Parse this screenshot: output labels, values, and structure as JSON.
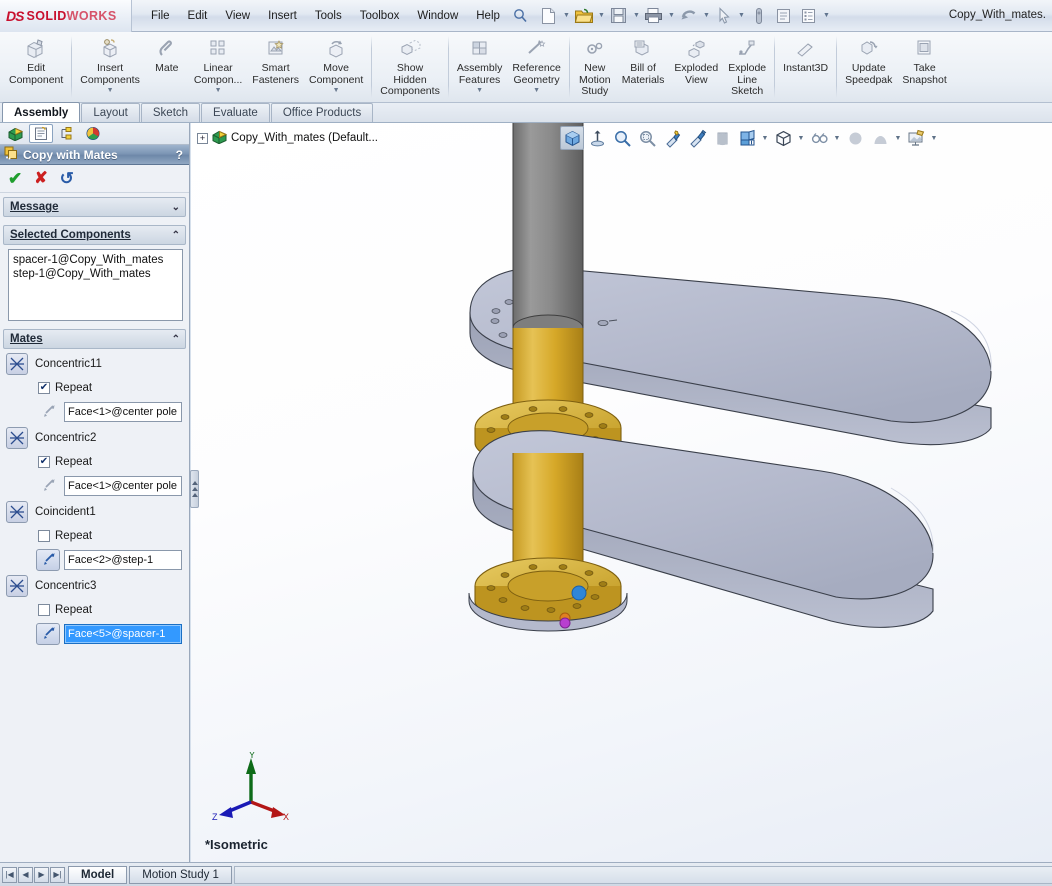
{
  "titlebar": {
    "brand_ds": "DS",
    "brand_solid": "SOLID",
    "brand_works": "WORKS",
    "document_title": "Copy_With_mates.",
    "menus": [
      "File",
      "Edit",
      "View",
      "Insert",
      "Tools",
      "Toolbox",
      "Window",
      "Help"
    ],
    "quick_icons": [
      {
        "name": "new-document-icon",
        "caret": true
      },
      {
        "name": "open-folder-icon",
        "caret": true
      },
      {
        "name": "save-icon",
        "caret": true
      },
      {
        "name": "print-icon",
        "caret": true
      },
      {
        "name": "undo-icon",
        "caret": true
      },
      {
        "name": "select-cursor-icon",
        "caret": true
      },
      {
        "name": "rebuild-icon",
        "caret": false
      },
      {
        "name": "options-icon",
        "caret": false
      },
      {
        "name": "properties-icon",
        "caret": true
      }
    ],
    "search_icon": "search-icon"
  },
  "ribbon": {
    "buttons": [
      {
        "label": "Edit\nComponent",
        "icon": "edit-component-icon",
        "dropdown": false,
        "sep_after": true
      },
      {
        "label": "Insert\nComponents",
        "icon": "insert-components-icon",
        "dropdown": true,
        "sep_after": false
      },
      {
        "label": "Mate",
        "icon": "mate-icon",
        "dropdown": false,
        "sep_after": false
      },
      {
        "label": "Linear\nCompon...",
        "icon": "linear-component-pattern-icon",
        "dropdown": true,
        "sep_after": false
      },
      {
        "label": "Smart\nFasteners",
        "icon": "smart-fasteners-icon",
        "dropdown": false,
        "sep_after": false
      },
      {
        "label": "Move\nComponent",
        "icon": "move-component-icon",
        "dropdown": true,
        "sep_after": false
      },
      {
        "label": "Show\nHidden\nComponents",
        "icon": "show-hidden-components-icon",
        "dropdown": false,
        "sep_after": true
      },
      {
        "label": "Assembly\nFeatures",
        "icon": "assembly-features-icon",
        "dropdown": true,
        "sep_after": false
      },
      {
        "label": "Reference\nGeometry",
        "icon": "reference-geometry-icon",
        "dropdown": true,
        "sep_after": true
      },
      {
        "label": "New\nMotion\nStudy",
        "icon": "new-motion-study-icon",
        "dropdown": false,
        "sep_after": false
      },
      {
        "label": "Bill of\nMaterials",
        "icon": "bill-of-materials-icon",
        "dropdown": false,
        "sep_after": false
      },
      {
        "label": "Exploded\nView",
        "icon": "exploded-view-icon",
        "dropdown": false,
        "sep_after": false
      },
      {
        "label": "Explode\nLine\nSketch",
        "icon": "explode-line-sketch-icon",
        "dropdown": false,
        "sep_after": true
      },
      {
        "label": "Instant3D",
        "icon": "instant3d-icon",
        "dropdown": false,
        "sep_after": true
      },
      {
        "label": "Update\nSpeedpak",
        "icon": "update-speedpak-icon",
        "dropdown": false,
        "sep_after": false
      },
      {
        "label": "Take\nSnapshot",
        "icon": "take-snapshot-icon",
        "dropdown": false,
        "sep_after": true
      }
    ]
  },
  "command_tabs": {
    "items": [
      "Assembly",
      "Layout",
      "Sketch",
      "Evaluate",
      "Office Products"
    ],
    "active": "Assembly"
  },
  "tree_tabs": [
    {
      "name": "feature-manager-tab",
      "selected": false
    },
    {
      "name": "property-manager-tab",
      "selected": true
    },
    {
      "name": "configuration-manager-tab",
      "selected": false
    },
    {
      "name": "display-manager-tab",
      "selected": false
    }
  ],
  "property_manager": {
    "title": "Copy with Mates",
    "help_label": "?",
    "icon": "copy-with-mates-icon",
    "actions": [
      {
        "name": "ok-button",
        "glyph": "✔",
        "color": "#1f9e2e"
      },
      {
        "name": "cancel-button",
        "glyph": "✘",
        "color": "#cc2020"
      },
      {
        "name": "back-button",
        "glyph": "↺",
        "color": "#2a5ca8"
      }
    ],
    "message_group": {
      "label": "Message",
      "collapsed": true,
      "chevron": "⌄"
    },
    "selected_components_group": {
      "label": "Selected Components",
      "collapsed": false,
      "chevron": "⌃"
    },
    "selected_components": [
      "spacer-1@Copy_With_mates",
      "step-1@Copy_With_mates"
    ],
    "mates_group": {
      "label": "Mates",
      "collapsed": false,
      "chevron": "⌃"
    },
    "mates": [
      {
        "name": "Concentric11",
        "icon": "concentric-mate-icon",
        "repeat_label": "Repeat",
        "repeat_checked": true,
        "face_button_active": false,
        "face_value": "Face<1>@center pole",
        "face_selected": false
      },
      {
        "name": "Concentric2",
        "icon": "concentric-mate-icon",
        "repeat_label": "Repeat",
        "repeat_checked": true,
        "face_button_active": false,
        "face_value": "Face<1>@center pole",
        "face_selected": false
      },
      {
        "name": "Coincident1",
        "icon": "coincident-mate-icon",
        "repeat_label": "Repeat",
        "repeat_checked": false,
        "face_button_active": true,
        "face_value": "Face<2>@step-1",
        "face_selected": false
      },
      {
        "name": "Concentric3",
        "icon": "concentric-mate-icon",
        "repeat_label": "Repeat",
        "repeat_checked": false,
        "face_button_active": true,
        "face_value": "Face<5>@spacer-1",
        "face_selected": true
      }
    ]
  },
  "graphics": {
    "tree_root_label": "Copy_With_mates  (Default...",
    "tree_root_icon": "assembly-icon",
    "expand_glyph": "+",
    "view_label": "*Isometric",
    "triad": {
      "x_label": "X",
      "y_label": "Y",
      "z_label": "Z",
      "x_color": "#cc1111",
      "y_color": "#117711",
      "z_color": "#1111cc"
    },
    "view_toolbar": [
      {
        "name": "zoom-to-fit-box-icon",
        "selected": true,
        "caret": false
      },
      {
        "name": "section-view-icon",
        "selected": false,
        "caret": false
      },
      {
        "name": "zoom-to-area-icon",
        "selected": false,
        "caret": false
      },
      {
        "name": "zoom-to-selection-icon",
        "selected": false,
        "caret": false
      },
      {
        "name": "hide-show-items-icon",
        "selected": false,
        "caret": false
      },
      {
        "name": "edit-appearance-icon",
        "selected": false,
        "caret": false
      },
      {
        "name": "apply-scene-icon",
        "selected": false,
        "caret": false
      },
      {
        "name": "view-orientation-icon",
        "selected": false,
        "caret": true
      },
      {
        "name": "display-style-icon",
        "selected": false,
        "caret": true
      },
      {
        "name": "view-settings-icon",
        "selected": false,
        "caret": true
      },
      {
        "name": "hide-show-components-icon",
        "selected": false,
        "caret": false
      },
      {
        "name": "appearances-icon",
        "selected": false,
        "caret": true
      },
      {
        "name": "scene-background-icon",
        "selected": false,
        "caret": true
      }
    ],
    "model_colors": {
      "plate_face": "#b5bacd",
      "plate_edge": "#3a3f4a",
      "spacer_gold": "#d6a828",
      "pole_gray": "#7b7b7b"
    }
  },
  "statusbar": {
    "nav_buttons": [
      "|◀",
      "◀",
      "▶",
      "▶|"
    ],
    "tabs": [
      {
        "label": "Model",
        "active": true
      },
      {
        "label": "Motion Study 1",
        "active": false
      }
    ]
  }
}
